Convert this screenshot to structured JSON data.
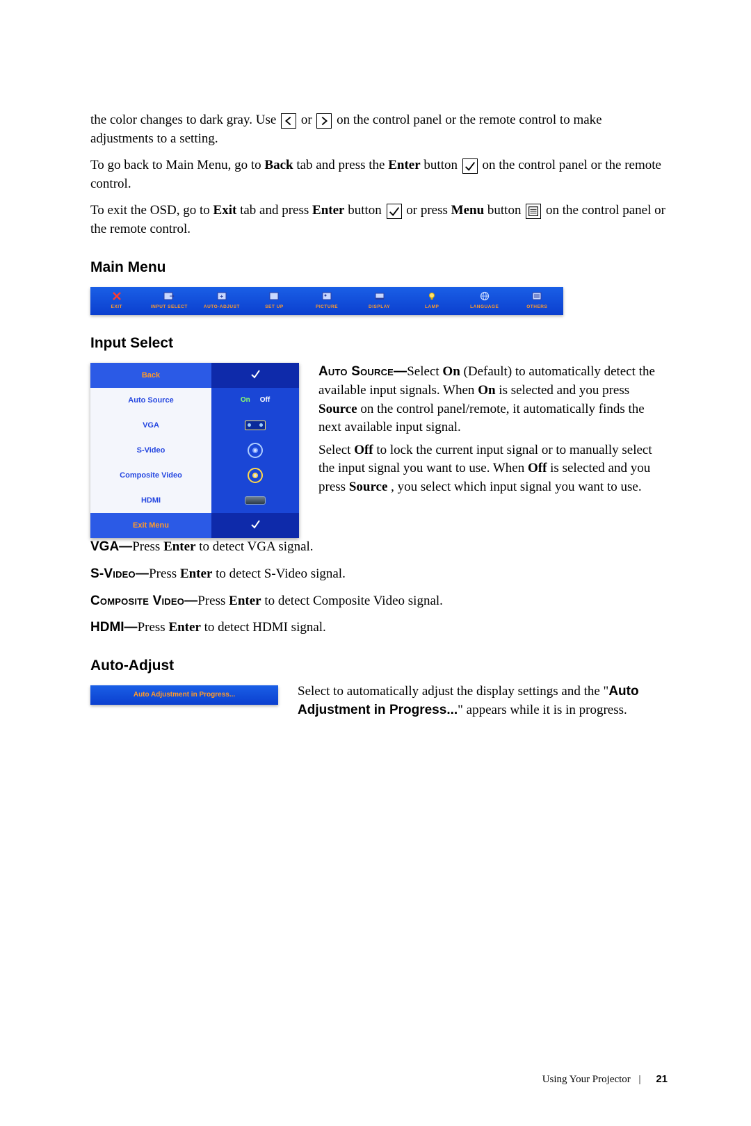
{
  "para1_a": "the color changes to dark gray. Use ",
  "para1_b": " or ",
  "para1_c": " on the control panel or the remote control to make adjustments to a setting.",
  "para2_a": "To go back to Main Menu, go to ",
  "para2_back": "Back",
  "para2_b": " tab and press the ",
  "para2_enter": "Enter",
  "para2_c": " button ",
  "para2_d": " on the control panel or the remote control.",
  "para3_a": "To exit the OSD, go to ",
  "para3_exit": "Exit",
  "para3_b": " tab and press ",
  "para3_enter": "Enter",
  "para3_c": " button ",
  "para3_d": " or press ",
  "para3_menu": "Menu",
  "para3_e": " button ",
  "para3_f": " on the control panel or the remote control.",
  "h_main": "Main Menu",
  "osd": [
    {
      "label": "EXIT"
    },
    {
      "label": "INPUT SELECT"
    },
    {
      "label": "AUTO-ADJUST"
    },
    {
      "label": "SET UP"
    },
    {
      "label": "PICTURE"
    },
    {
      "label": "DISPLAY"
    },
    {
      "label": "LAMP"
    },
    {
      "label": "LANGUAGE"
    },
    {
      "label": "OTHERS"
    }
  ],
  "h_input": "Input Select",
  "panel": {
    "back": "Back",
    "autosource": "Auto Source",
    "on": "On",
    "off": "Off",
    "vga": "VGA",
    "svideo": "S-Video",
    "composite": "Composite Video",
    "hdmi": "HDMI",
    "exit": "Exit Menu"
  },
  "as_label": "Auto Source—",
  "as_a": "Select ",
  "as_on": "On",
  "as_b": " (Default) to automatically detect the available input signals. When ",
  "as_on2": "On",
  "as_c": " is selected and you press ",
  "as_source": "Source",
  "as_d": " on the control panel/remote, it automatically finds the next available input signal.",
  "as_e": "Select ",
  "as_off": "Off",
  "as_f": " to lock the current input signal or to manually select the input signal you want to use. When ",
  "as_off2": "Off",
  "as_g": " is selected and you press ",
  "as_source2": "Source ",
  "as_h": ", you select which input signal you want to use.",
  "vga_l": "VGA—",
  "vga_a": "Press ",
  "vga_enter": "Enter",
  "vga_b": " to detect VGA signal.",
  "sv_l": "S-Video—",
  "sv_a": "Press ",
  "sv_enter": "Enter",
  "sv_b": " to detect S-Video signal.",
  "cv_l": "Composite Video—",
  "cv_a": "Press ",
  "cv_enter": "Enter",
  "cv_b": " to detect Composite Video signal.",
  "hd_l": "HDMI—",
  "hd_a": "Press ",
  "hd_enter": "Enter",
  "hd_b": " to detect HDMI signal.",
  "h_auto": "Auto-Adjust",
  "auto_bar": "Auto Adjustment in Progress...",
  "auto_a": "Select to automatically adjust the display settings and the \"",
  "auto_label": "Auto Adjustment in Progress...",
  "auto_b": "\" appears while it is in progress.",
  "footer_text": "Using Your Projector",
  "footer_page": "21"
}
